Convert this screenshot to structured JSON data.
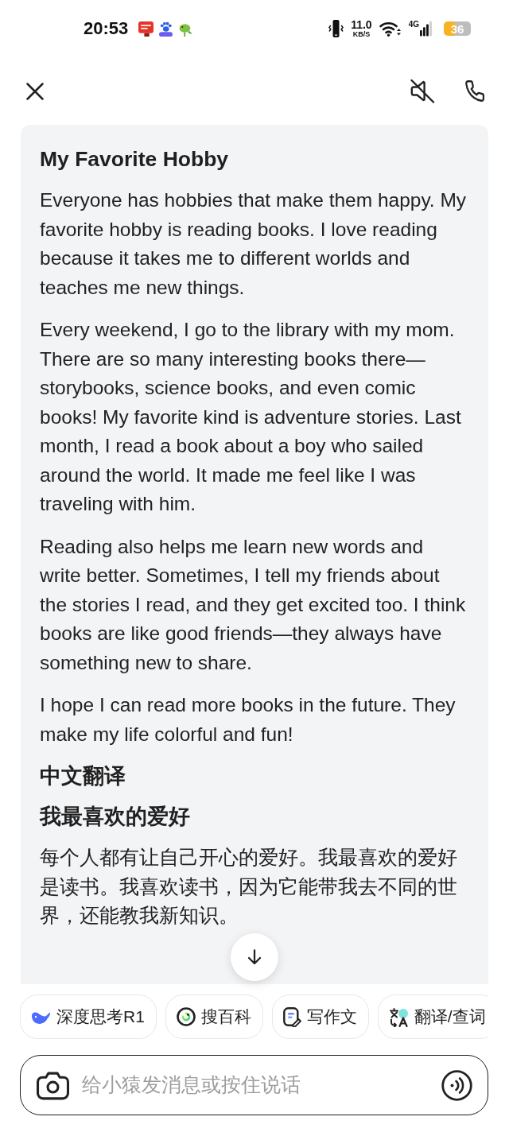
{
  "status_bar": {
    "time": "20:53",
    "network_speed": "11.0",
    "network_speed_unit": "KB/S",
    "network_type": "4G",
    "battery": "36"
  },
  "header": {
    "sound_muted": true
  },
  "message": {
    "blocks": [
      {
        "kind": "heading",
        "text": "My Favorite Hobby"
      },
      {
        "kind": "paragraph",
        "text": "Everyone has hobbies that make them happy. My\nfavorite hobby is reading books. I love reading\nbecause it takes me to different worlds and\nteaches me new things."
      },
      {
        "kind": "paragraph",
        "text": "Every weekend, I go to the library with my mom.\nThere are so many interesting books there—\nstorybooks, science books, and even comic\nbooks! My favorite kind is adventure stories. Last\nmonth, I read a book about a boy who sailed\naround the world. It made me feel like I was\ntraveling with him."
      },
      {
        "kind": "paragraph",
        "text": "Reading also helps me learn new words and\nwrite better. Sometimes, I tell my friends about\nthe stories I read, and they get excited too. I think\nbooks are like good friends—they always have\nsomething new to share."
      },
      {
        "kind": "paragraph",
        "text": "I hope I can read more books in the future. They\nmake my life colorful and fun!"
      },
      {
        "kind": "heading",
        "text": "中文翻译"
      },
      {
        "kind": "heading",
        "text": "我最喜欢的爱好"
      },
      {
        "kind": "paragraph",
        "text": "每个人都有让自己开心的爱好。我最喜欢的爱好是读书。我喜欢读书，因为它能带我去不同的世界，还能教我新知识。"
      }
    ]
  },
  "shortcuts": [
    {
      "label": "深度思考R1"
    },
    {
      "label": "搜百科"
    },
    {
      "label": "写作文"
    },
    {
      "label": "翻译/查词"
    }
  ],
  "composer": {
    "placeholder": "给小猿发消息或按住说话"
  }
}
